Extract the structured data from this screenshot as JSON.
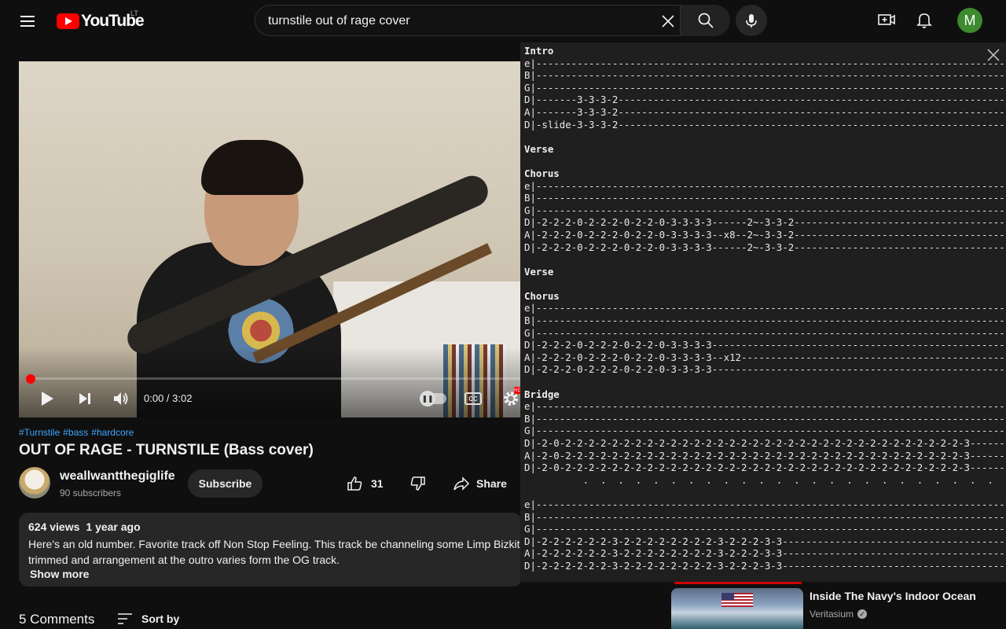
{
  "header": {
    "logo_text": "YouTube",
    "country_code": "LT",
    "search_value": "turnstile out of rage cover",
    "avatar_letter": "M"
  },
  "player": {
    "time_current": "0:00",
    "time_total": "3:02",
    "time_display": "0:00 / 3:02",
    "progress_fraction": 0.0,
    "cc_label": "CC",
    "hd_label": "HD"
  },
  "video": {
    "hashtags": [
      "#Turnstile",
      "#bass",
      "#hardcore"
    ],
    "title": "OUT OF RAGE - TURNSTILE (Bass cover)",
    "channel_name": "weallwantthegiglife",
    "subscribers": "90 subscribers",
    "subscribe_label": "Subscribe",
    "like_count": "31",
    "share_label": "Share"
  },
  "description": {
    "views": "624 views",
    "age": "1 year ago",
    "line1": "Here's an old number. Favorite track off Non Stop Feeling. This track be channeling some Limp Bizkit v",
    "line2": "trimmed and arrangement at the outro varies form the OG track.",
    "show_more": "Show more"
  },
  "comments": {
    "count_label": "5 Comments",
    "sort_label": "Sort by"
  },
  "tab": {
    "lines": [
      "Intro",
      "e|--------------------------------------------------------------------------------------|",
      "B|--------------------------------------------------------------------------------------|",
      "G|--------------------------------------------------------------------------------------|",
      "D|-------3-3-3-2------------------------------------------------------------------------|",
      "A|-------3-3-3-2------------------------------------------------------------------------|",
      "D|-slide-3-3-3-2------------------------------------------------------------------------|",
      "",
      "Verse",
      "",
      "Chorus",
      "e|--------------------------------------------------------------------------------------|",
      "B|--------------------------------------------------------------------------------------|",
      "G|--------------------------------------------------------------------------------------|",
      "D|-2-2-2-0-2-2-2-0-2-2-0-3-3-3-3------2~-3-3-2------------------------------------------|",
      "A|-2-2-2-0-2-2-2-0-2-2-0-3-3-3-3--x8--2~-3-3-2------------------------------------------|",
      "D|-2-2-2-0-2-2-2-0-2-2-0-3-3-3-3------2~-3-3-2------------------------------------------|",
      "",
      "Verse",
      "",
      "Chorus",
      "e|--------------------------------------------------------------------------------------|",
      "B|--------------------------------------------------------------------------------------|",
      "G|--------------------------------------------------------------------------------------|",
      "D|-2-2-2-0-2-2-2-0-2-2-0-3-3-3-3--------------------------------------------------------|",
      "A|-2-2-2-0-2-2-2-0-2-2-0-3-3-3-3--x12---------------------------------------------------|",
      "D|-2-2-2-0-2-2-2-0-2-2-0-3-3-3-3--------------------------------------------------------|",
      "",
      "Bridge",
      "e|--------------------------------------------------------------------------------------|",
      "B|--------------------------------------------------------------------------------------|",
      "G|--------------------------------------------------------------------------------------|",
      "D|-2-0-2-2-2-2-2-2-2-2-2-2-2-2-2-2-2-2-2-2-2-2-2-2-2-2-2-2-2-2-2-2-2-2-2-2-3------------|",
      "A|-2-0-2-2-2-2-2-2-2-2-2-2-2-2-2-2-2-2-2-2-2-2-2-2-2-2-2-2-2-2-2-2-2-2-2-2-3------------|",
      "D|-2-0-2-2-2-2-2-2-2-2-2-2-2-2-2-2-2-2-2-2-2-2-2-2-2-2-2-2-2-2-2-2-2-2-2-2-3------------|",
      "          .  .  .  .  .  .  .  .  .  .  .  .  .  .  .  .  .  .  .  .  .  .  .  .",
      "",
      "e|--------------------------------------------------------------------------------------|",
      "B|--------------------------------------------------------------------------------------|",
      "G|--------------------------------------------------------------------------------------|",
      "D|-2-2-2-2-2-2-3-2-2-2-2-2-2-2-2-3-2-2-2-3-3--------------------------------------------|",
      "A|-2-2-2-2-2-2-3-2-2-2-2-2-2-2-2-3-2-2-2-3-3--------------------------------------------|",
      "D|-2-2-2-2-2-2-3-2-2-2-2-2-2-2-2-3-2-2-2-3-3--------------------------------------------|"
    ],
    "headings": [
      "Intro",
      "Verse",
      "Chorus",
      "Bridge"
    ]
  },
  "recommendation": {
    "title": "Inside The Navy's Indoor Ocean",
    "channel": "Veritasium"
  }
}
